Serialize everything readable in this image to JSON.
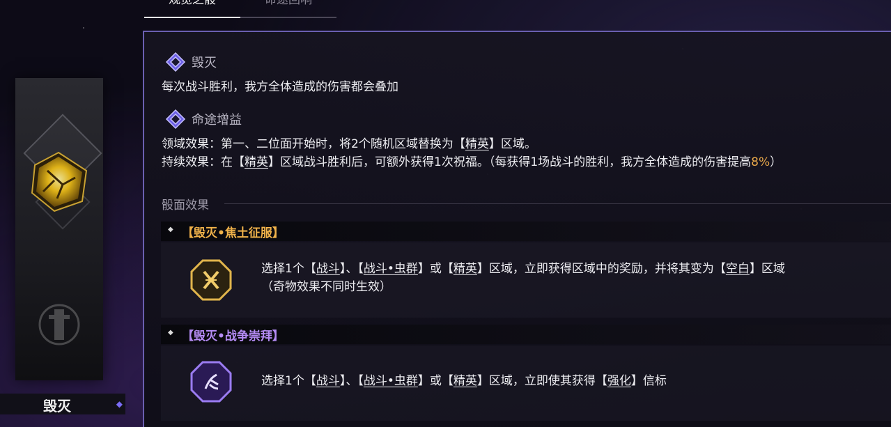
{
  "tabs": [
    {
      "label": "观览之骰",
      "active": true
    },
    {
      "label": "命途回响",
      "active": false
    }
  ],
  "sidebar": {
    "path_name": "毁灭"
  },
  "path": {
    "title": "毁灭",
    "description": "每次战斗胜利，我方全体造成的伤害都会叠加",
    "buff_title": "命途增益",
    "domain_effect": {
      "prefix": "领域效果：第一、二位面开始时，将2个随机区域替换为【",
      "elite": "精英",
      "suffix": "】区域。"
    },
    "continuous_effect": {
      "prefix": "持续效果：在【",
      "elite": "精英",
      "middle": "】区域战斗胜利后，可额外获得1次祝福。（每获得1场战斗的胜利，我方全体造成的伤害提高",
      "percent": "8%",
      "suffix": "）"
    }
  },
  "dice_faces": {
    "label": "骰面效果",
    "items": [
      {
        "name": "【毁灭•焦土征服】",
        "name_color": "#f0b24a",
        "icon": "golden-octagon-x-icon",
        "text": {
          "p1": "选择1个【",
          "w1": "战斗",
          "p2": "】、【",
          "w2": "战斗•虫群",
          "p3": "】或【",
          "w3": "精英",
          "p4": "】区域，立即获得区域中的奖励，并将其变为【",
          "w4": "空白",
          "p5": "】区域",
          "line2": "（奇物效果不同时生效）"
        }
      },
      {
        "name": "【毁灭•战争崇拜】",
        "name_color": "#b58cf5",
        "icon": "purple-octagon-scythe-icon",
        "text": {
          "p1": "选择1个【",
          "w1": "战斗",
          "p2": "】、【",
          "w2": "战斗•虫群",
          "p3": "】或【",
          "w3": "精英",
          "p4": "】区域，立即使其获得【",
          "w4": "强化",
          "p5": "】信标"
        }
      }
    ]
  }
}
